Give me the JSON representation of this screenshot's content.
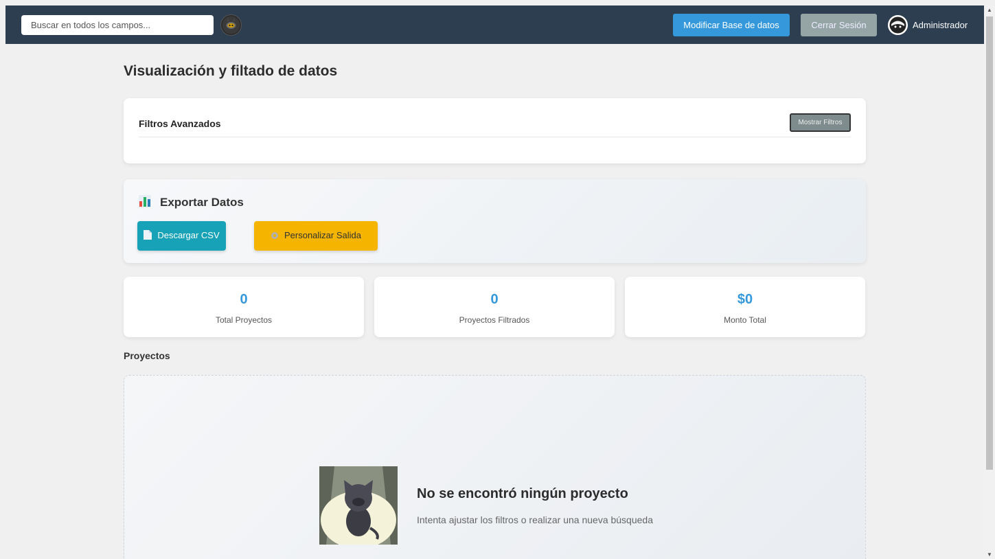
{
  "header": {
    "search_placeholder": "Buscar en todos los campos...",
    "modify_db_label": "Modificar Base de datos",
    "logout_label": "Cerrar Sesión",
    "username": "Administrador"
  },
  "main": {
    "title": "Visualización y filtado de datos",
    "filters": {
      "title": "Filtros Avanzados",
      "show_button": "Mostrar Filtros"
    },
    "export": {
      "title": "Exportar Datos",
      "csv_button": "Descargar CSV",
      "custom_button": "Personalizar Salida"
    },
    "stats": [
      {
        "value": "0",
        "label": "Total Proyectos"
      },
      {
        "value": "0",
        "label": "Proyectos Filtrados"
      },
      {
        "value": "$0",
        "label": "Monto Total"
      }
    ],
    "projects": {
      "title": "Proyectos",
      "empty_title": "No se encontró ningún proyecto",
      "empty_subtitle": "Intenta ajustar los filtros o realizar una nueva búsqueda"
    }
  },
  "colors": {
    "header_bg": "#2c3e50",
    "primary": "#3498db",
    "secondary": "#95a5a6",
    "info": "#17a2b8",
    "warning": "#f4b400"
  },
  "icons": {
    "logo": "cat-logo-icon",
    "avatar": "user-avatar-icon",
    "export": "bar-chart-icon",
    "csv": "document-icon",
    "custom": "gear-icon",
    "empty": "cat-illustration"
  }
}
